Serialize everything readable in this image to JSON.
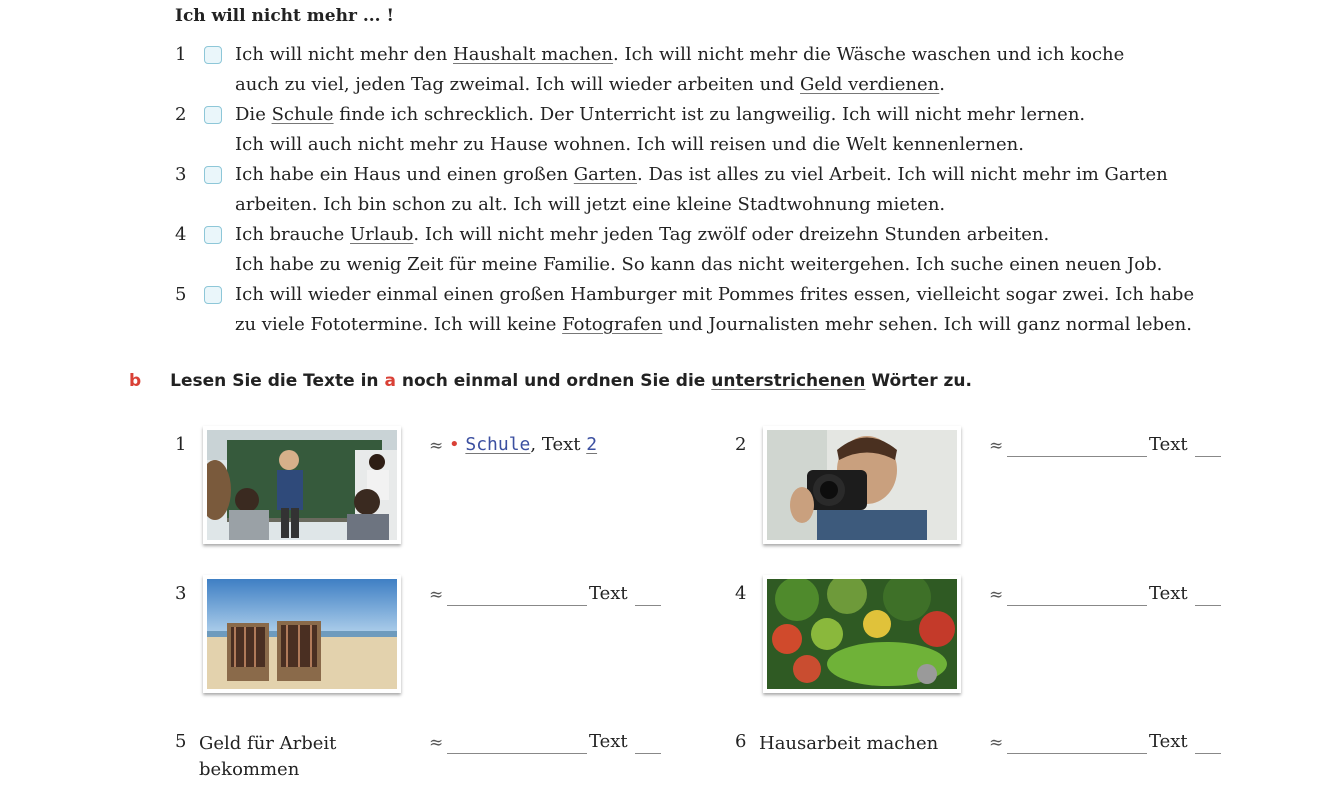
{
  "heading": "Ich will nicht mehr ... !",
  "items": [
    {
      "num": "1",
      "line1": [
        "Ich will nicht mehr den ",
        {
          "u": "Haushalt machen"
        },
        ". Ich will nicht mehr die Wäsche waschen und ich koche"
      ],
      "line2": [
        "auch zu viel, jeden Tag zweimal. Ich will wieder arbeiten und ",
        {
          "u": "Geld verdienen"
        },
        "."
      ]
    },
    {
      "num": "2",
      "line1": [
        "Die ",
        {
          "u": "Schule"
        },
        " finde ich schrecklich. Der Unterricht ist zu langweilig. Ich will nicht mehr lernen."
      ],
      "line2": [
        "Ich will auch nicht mehr zu Hause wohnen. Ich will reisen und die Welt kennenlernen."
      ]
    },
    {
      "num": "3",
      "line1": [
        "Ich habe ein Haus und einen großen ",
        {
          "u": "Garten"
        },
        ". Das ist alles zu viel Arbeit. Ich will nicht mehr im Garten"
      ],
      "line2": [
        "arbeiten. Ich bin schon zu alt. Ich will jetzt eine kleine Stadtwohnung mieten."
      ]
    },
    {
      "num": "4",
      "line1": [
        "Ich brauche ",
        {
          "u": "Urlaub"
        },
        ". Ich will nicht mehr jeden Tag zwölf oder dreizehn Stunden arbeiten."
      ],
      "line2": [
        "Ich habe zu wenig Zeit für meine Familie. So kann das nicht weitergehen. Ich suche einen neuen Job."
      ]
    },
    {
      "num": "5",
      "line1": [
        "Ich will wieder einmal einen großen Hamburger mit Pommes frites essen, vielleicht sogar zwei. Ich habe"
      ],
      "line2": [
        "zu viele Fototermine. Ich will keine ",
        {
          "u": "Fotografen"
        },
        " und Journalisten mehr sehen. Ich will ganz normal leben."
      ]
    }
  ],
  "task": {
    "letter": "b",
    "p1": "Lesen Sie die Texte in ",
    "ref": "a",
    "p2": " noch einmal und ordnen Sie die ",
    "underlined": "unterstrichenen",
    "p3": " Wörter zu."
  },
  "approx": "≈",
  "text_label": "Text",
  "example": {
    "dot": "•",
    "word": "Schule",
    "sep": ", Text",
    "num": "2"
  },
  "cells": [
    {
      "num": "1",
      "image": "classroom-photo"
    },
    {
      "num": "2",
      "image": "photographer-photo"
    },
    {
      "num": "3",
      "image": "beach-chairs-photo"
    },
    {
      "num": "4",
      "image": "garden-photo"
    }
  ],
  "cell5": {
    "num": "5",
    "desc1": "Geld für Arbeit",
    "desc2": "bekommen"
  },
  "cell6": {
    "num": "6",
    "desc": "Hausarbeit machen"
  }
}
